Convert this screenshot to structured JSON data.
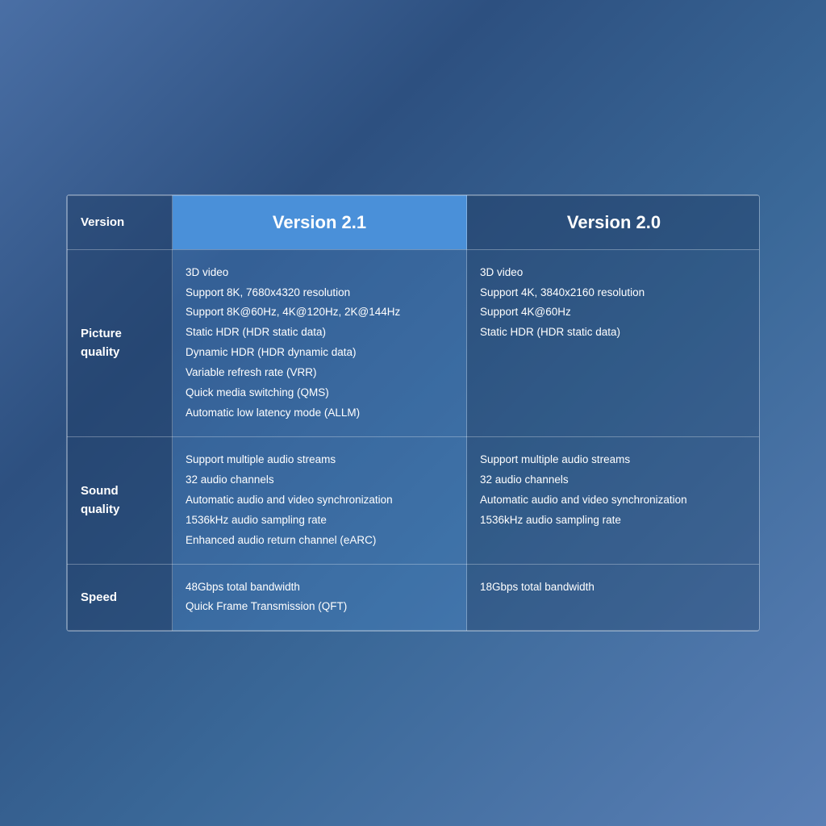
{
  "table": {
    "header": {
      "label": "Version",
      "v21": "Version 2.1",
      "v20": "Version 2.0"
    },
    "rows": [
      {
        "label": "Picture quality",
        "v21_features": [
          "3D video",
          "Support 8K, 7680x4320 resolution",
          "Support 8K@60Hz, 4K@120Hz, 2K@144Hz",
          "Static HDR (HDR static data)",
          "Dynamic HDR (HDR dynamic data)",
          "Variable refresh rate (VRR)",
          "Quick media switching (QMS)",
          "Automatic low latency mode (ALLM)"
        ],
        "v20_features": [
          "3D video",
          "Support 4K, 3840x2160 resolution",
          "Support 4K@60Hz",
          "Static HDR (HDR static data)"
        ]
      },
      {
        "label": "Sound quality",
        "v21_features": [
          "Support multiple audio streams",
          "32 audio channels",
          "Automatic audio and video synchronization",
          "1536kHz audio sampling rate",
          "Enhanced audio return channel (eARC)"
        ],
        "v20_features": [
          "Support multiple audio streams",
          "32 audio channels",
          "Automatic audio and video synchronization",
          "1536kHz audio sampling rate"
        ]
      },
      {
        "label": "Speed",
        "v21_features": [
          "48Gbps total bandwidth",
          "Quick Frame Transmission (QFT)"
        ],
        "v20_features": [
          "18Gbps total bandwidth"
        ]
      }
    ]
  }
}
